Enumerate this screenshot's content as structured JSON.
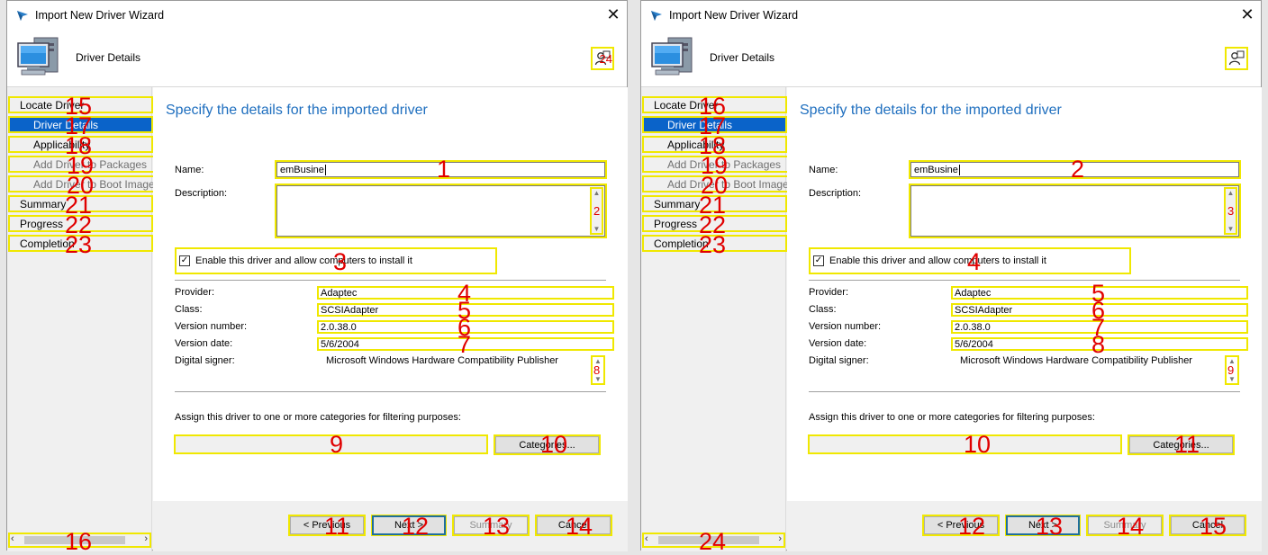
{
  "wizard": {
    "title": "Import New Driver Wizard",
    "header_title": "Driver Details",
    "nav": [
      {
        "label": "Locate Driver",
        "level": "top",
        "state": "normal"
      },
      {
        "label": "Driver Details",
        "level": "sub",
        "state": "selected"
      },
      {
        "label": "Applicability",
        "level": "sub",
        "state": "normal"
      },
      {
        "label": "Add Driver to Packages",
        "level": "sub",
        "state": "disabled"
      },
      {
        "label": "Add Driver to Boot Image",
        "level": "sub",
        "state": "disabled"
      },
      {
        "label": "Summary",
        "level": "top",
        "state": "normal"
      },
      {
        "label": "Progress",
        "level": "top",
        "state": "normal"
      },
      {
        "label": "Completion",
        "level": "top",
        "state": "normal"
      }
    ],
    "heading": "Specify the details for the imported driver",
    "name_label": "Name:",
    "name_value": "emBusine",
    "description_label": "Description:",
    "description_value": "",
    "enable_checkbox_label": "Enable this driver and allow computers to install it",
    "enable_checked": true,
    "provider_label": "Provider:",
    "provider_value": "Adaptec",
    "class_label": "Class:",
    "class_value": "SCSIAdapter",
    "version_number_label": "Version number:",
    "version_number_value": "2.0.38.0",
    "version_date_label": "Version date:",
    "version_date_value": "5/6/2004",
    "digital_signer_label": "Digital signer:",
    "digital_signer_value": "Microsoft Windows Hardware Compatibility Publisher",
    "categories_prompt": "Assign this driver to one or more categories for filtering purposes:",
    "categories_value": "",
    "categories_button": "Categories...",
    "previous_button": "< Previous",
    "next_button": "Next >",
    "summary_button": "Summary",
    "cancel_button": "Cancel",
    "close_glyph": "✕",
    "checkmark_glyph": "✓"
  },
  "windows": [
    {
      "id": "left",
      "tags": {
        "name_input": "1",
        "desc_scroll": "2",
        "enable_check": "3",
        "provider": "4",
        "class": "5",
        "version_number": "6",
        "version_date": "7",
        "signer_scroll": "8",
        "categories_field": "9",
        "categories_button": "10",
        "previous": "11",
        "next": "12",
        "summary": "13",
        "cancel": "14",
        "nav_0": "15",
        "nav_1": "17",
        "nav_2": "18",
        "nav_3": "19",
        "nav_4": "20",
        "nav_5": "21",
        "nav_6": "22",
        "nav_7": "23",
        "hscroll": "16",
        "help": "24"
      }
    },
    {
      "id": "right",
      "tags": {
        "name_input": "2",
        "desc_scroll": "3",
        "enable_check": "4",
        "provider": "5",
        "class": "6",
        "version_number": "7",
        "version_date": "8",
        "signer_scroll": "9",
        "categories_field": "10",
        "categories_button": "11",
        "previous": "12",
        "next": "13",
        "summary": "14",
        "cancel": "15",
        "nav_0": "16",
        "nav_1": "17",
        "nav_2": "18",
        "nav_3": "19",
        "nav_4": "20",
        "nav_5": "21",
        "nav_6": "22",
        "nav_7": "23",
        "hscroll": "24",
        "help": ""
      }
    }
  ],
  "colors": {
    "accent_blue": "#0a63c9",
    "heading_blue": "#1f6fbf",
    "annotation_yellow": "#f0e800",
    "annotation_red": "#e00000"
  }
}
